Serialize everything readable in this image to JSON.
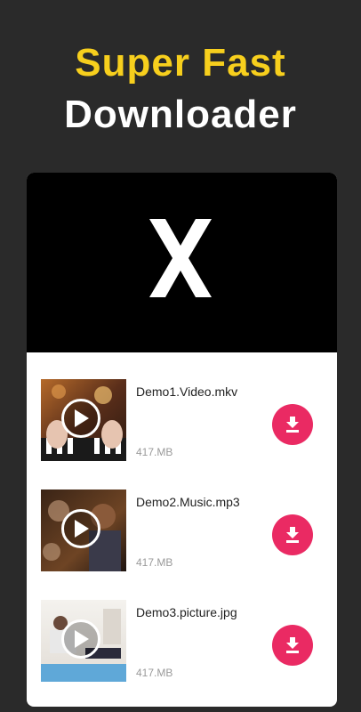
{
  "headline": {
    "line1": "Super Fast",
    "line2": "Downloader"
  },
  "banner": {
    "logo_icon": "x-logo-icon"
  },
  "files": [
    {
      "name": "Demo1.Video.mkv",
      "size": "417.MB"
    },
    {
      "name": "Demo2.Music.mp3",
      "size": "417.MB"
    },
    {
      "name": "Demo3.picture.jpg",
      "size": "417.MB"
    }
  ],
  "colors": {
    "accent": "#f7cf1d",
    "download_button": "#ea2a63",
    "background": "#2a2a2a"
  }
}
